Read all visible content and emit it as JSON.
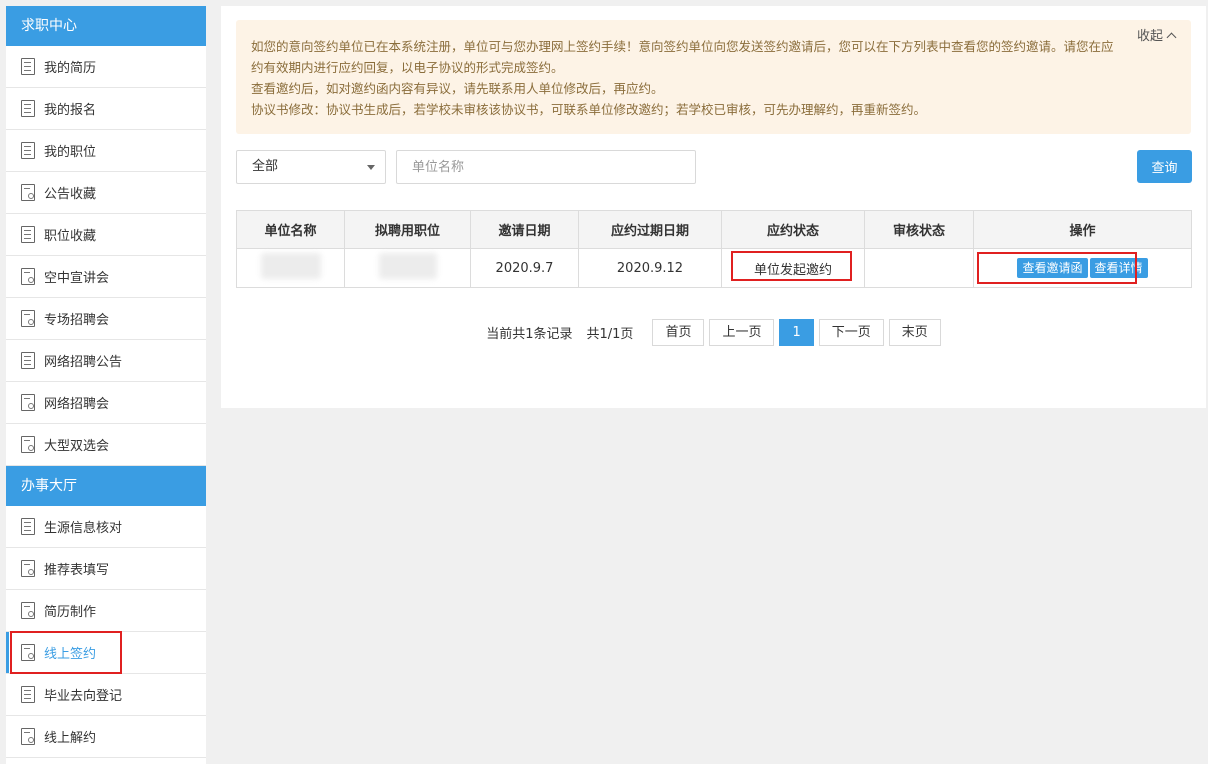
{
  "sidebar": {
    "job_center": {
      "title": "求职中心",
      "items": [
        {
          "label": "我的简历"
        },
        {
          "label": "我的报名"
        },
        {
          "label": "我的职位"
        },
        {
          "label": "公告收藏"
        },
        {
          "label": "职位收藏"
        },
        {
          "label": "空中宣讲会"
        },
        {
          "label": "专场招聘会"
        },
        {
          "label": "网络招聘公告"
        },
        {
          "label": "网络招聘会"
        },
        {
          "label": "大型双选会"
        }
      ]
    },
    "service_hall": {
      "title": "办事大厅",
      "items": [
        {
          "label": "生源信息核对"
        },
        {
          "label": "推荐表填写"
        },
        {
          "label": "简历制作"
        },
        {
          "label": "线上签约"
        },
        {
          "label": "毕业去向登记"
        },
        {
          "label": "线上解约"
        }
      ]
    }
  },
  "notice": {
    "line1": "如您的意向签约单位已在本系统注册，单位可与您办理网上签约手续！意向签约单位向您发送签约邀请后，您可以在下方列表中查看您的签约邀请。请您在应约有效期内进行应约回复，以电子协议的形式完成签约。",
    "line2": "查看邀约后，如对邀约函内容有异议，请先联系用人单位修改后，再应约。",
    "line3": "协议书修改：协议书生成后，若学校未审核该协议书，可联系单位修改邀约；若学校已审核，可先办理解约，再重新签约。",
    "collapse_label": "收起"
  },
  "filter": {
    "select_value": "全部",
    "search_placeholder": "单位名称",
    "query_label": "查询"
  },
  "table": {
    "headers": [
      "单位名称",
      "拟聘用职位",
      "邀请日期",
      "应约过期日期",
      "应约状态",
      "审核状态",
      "操作"
    ],
    "rows": [
      {
        "invite_date": "2020.9.7",
        "expire_date": "2020.9.12",
        "status": "单位发起邀约",
        "audit": "",
        "actions": [
          "查看邀请函",
          "查看详情"
        ]
      }
    ]
  },
  "pager": {
    "records": "当前共1条记录",
    "pages": "共1/1页",
    "first": "首页",
    "prev": "上一页",
    "current": "1",
    "next": "下一页",
    "last": "末页"
  },
  "colors": {
    "primary": "#3a9de3",
    "notice_bg": "#fdf3e6",
    "highlight": "#e02020"
  }
}
